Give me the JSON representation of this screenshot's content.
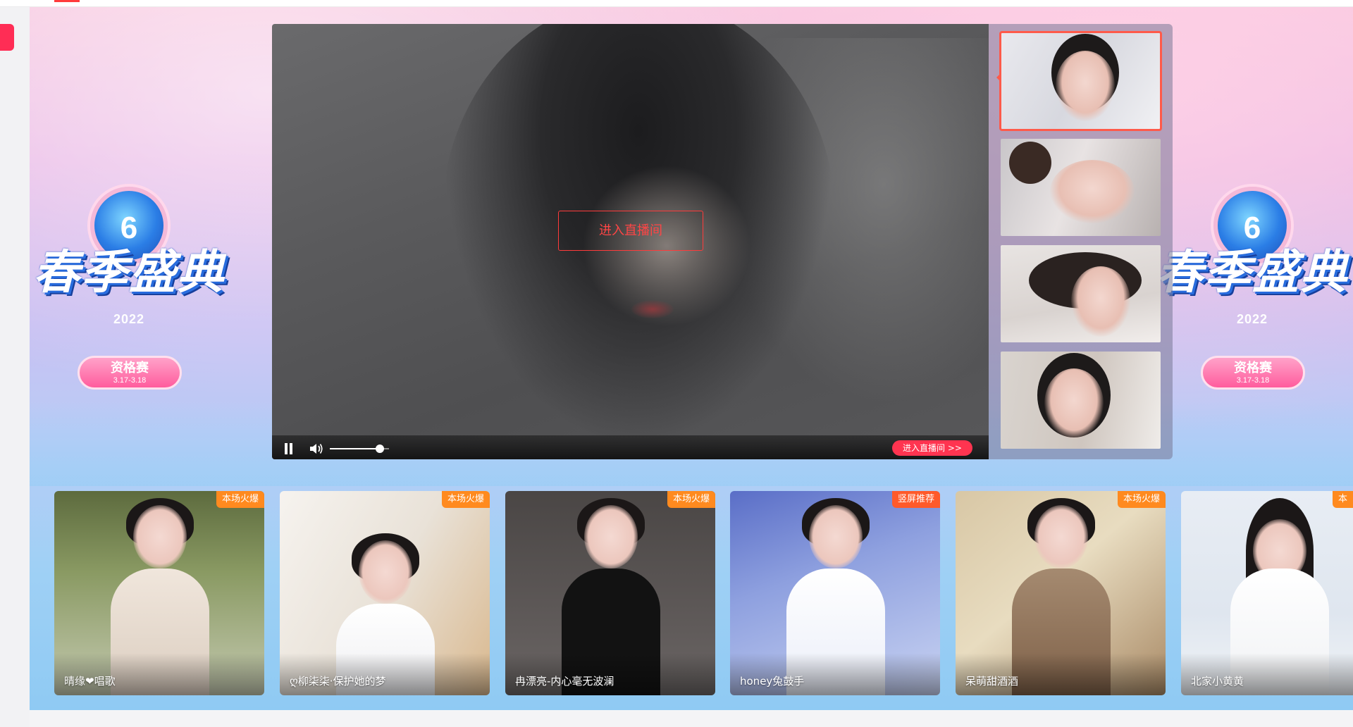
{
  "festival": {
    "title": "春季盛典",
    "year": "2022",
    "badge_number": "6",
    "stage": "资格赛",
    "dates": "3.17-3.18"
  },
  "player": {
    "enter_room_label": "进入直播间",
    "enter_room_small_label": "进入直播间 >>",
    "volume_level": 0.85,
    "state": "playing"
  },
  "thumbnails": [
    {
      "name": "thumbnail-1",
      "active": true
    },
    {
      "name": "thumbnail-2",
      "active": false
    },
    {
      "name": "thumbnail-3",
      "active": false
    },
    {
      "name": "thumbnail-4",
      "active": false
    }
  ],
  "cards": [
    {
      "name": "晴缘❤唱歌",
      "badge": "本场火爆"
    },
    {
      "name": "ღ柳柒柒·保护她的梦",
      "badge": "本场火爆"
    },
    {
      "name": "冉漂亮-内心毫无波澜",
      "badge": "本场火爆"
    },
    {
      "name": "honey兔鼓手",
      "badge": "竖屏推荐"
    },
    {
      "name": "呆萌甜酒酒",
      "badge": "本场火爆"
    },
    {
      "name": "北家小黄黄",
      "badge": "本"
    }
  ],
  "colors": {
    "accent_red": "#ff3450",
    "badge_orange": "#ff8a1f",
    "active_outline": "#ff5a4a"
  },
  "icons": [
    "pause-icon",
    "volume-icon"
  ]
}
